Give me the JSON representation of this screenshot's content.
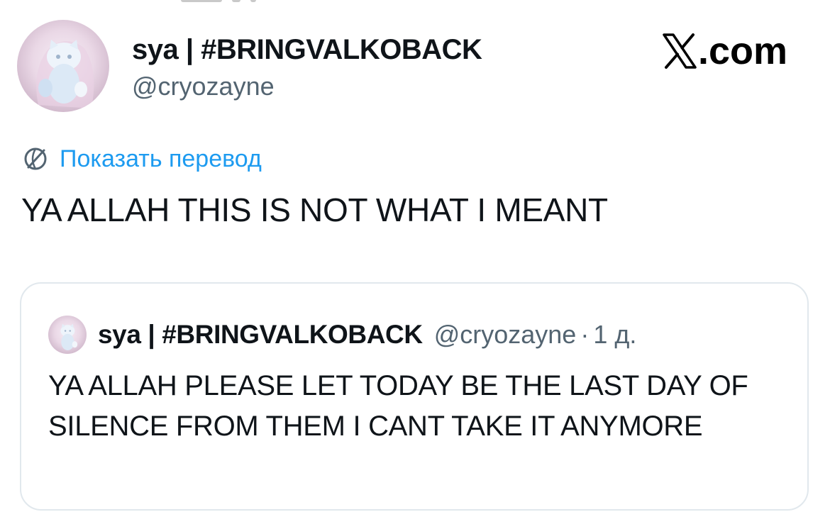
{
  "tweet": {
    "author_name": "sya | #BRINGVALKOBACK",
    "author_handle": "@cryozayne",
    "brand_label": ".com",
    "translate_label": "Показать перевод",
    "text": "YA ALLAH THIS IS NOT WHAT I MEANT"
  },
  "quote": {
    "author_name": "sya | #BRINGVALKOBACK",
    "author_handle": "@cryozayne",
    "separator": "·",
    "time": "1 д.",
    "text": "YA ALLAH PLEASE LET TODAY BE THE LAST DAY OF SILENCE FROM THEM I CANT TAKE IT ANYMORE"
  },
  "icons": {
    "brand": "x-logo-icon",
    "translate": "globe-icon",
    "avatar": "cat-figurine-avatar"
  },
  "colors": {
    "link": "#1d9bf0",
    "secondary_text": "#536471",
    "border": "#e1e8ed"
  }
}
